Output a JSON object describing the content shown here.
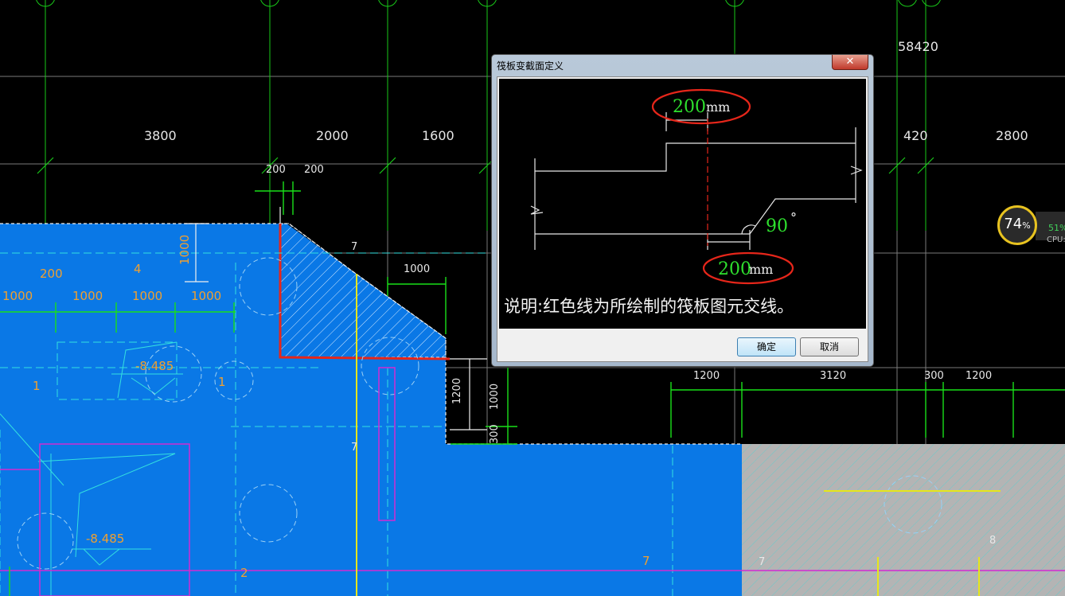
{
  "cad": {
    "top_total": "58420",
    "dims_top_row": [
      "3800",
      "2000",
      "1600",
      "420",
      "2800"
    ],
    "dims_small_top": [
      "200",
      "200"
    ],
    "dim_vertical_left": "1000",
    "dim_1000_right": "1000",
    "dim_200_left": "200",
    "dims_row_1000": [
      "1000",
      "1000",
      "1000",
      "1000"
    ],
    "elevation_1": "-8.485",
    "elevation_2": "-8.485",
    "dim_1200_vert": "1200",
    "dim_1000_vert": "1000",
    "dim_300_vert": "300",
    "dims_right_row": [
      "1200",
      "3120",
      "300",
      "1200"
    ],
    "labels": [
      "7",
      "4",
      "1",
      "1",
      "7",
      "7",
      "7",
      "8",
      "2"
    ],
    "colors": {
      "slab_blue": "#0a78e6",
      "slab_gray": "#b4b4b4",
      "grid_green": "#19d219",
      "grid_gray": "#808080",
      "highlight_red": "#e6261a",
      "magenta": "#d22ad2",
      "yellow": "#e6e61a",
      "cyan": "#33e0e0"
    }
  },
  "dialog": {
    "title": "筏板变截面定义",
    "close_glyph": "✕",
    "dim_top_value": "200",
    "dim_top_unit": "mm",
    "angle_value": "90",
    "angle_unit": "°",
    "dim_bottom_value": "200",
    "dim_bottom_unit": "mm",
    "note": "说明:红色线为所绘制的筏板图元交线。",
    "ok_label": "确定",
    "cancel_label": "取消"
  },
  "cpu_widget": {
    "usage": "74",
    "usage_unit": "%",
    "secondary_pct": "51%",
    "label": "CPU:"
  }
}
